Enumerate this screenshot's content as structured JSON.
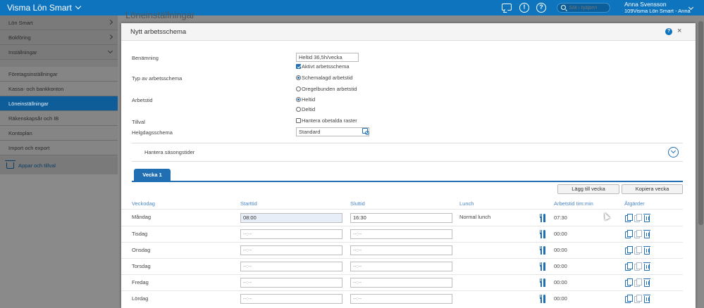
{
  "topbar": {
    "app_title": "Visma Lön Smart",
    "search_placeholder": "Sök i hjälpen",
    "help_symbol": "?",
    "alert_symbol": "!",
    "user_name": "Anna Svensson",
    "user_company": "109Visma Lön Smart - Anna",
    "accent": "#0e74bd"
  },
  "sidebar": {
    "items": [
      {
        "label": "Lön Smart"
      },
      {
        "label": "Bokföring"
      },
      {
        "label": "Inställningar"
      },
      {
        "label": "Företagsinställningar"
      },
      {
        "label": "Kassa- och bankkonton"
      },
      {
        "label": "Löneinställningar"
      },
      {
        "label": "Räkenskapsår och IB"
      },
      {
        "label": "Kontoplan"
      },
      {
        "label": "Import och export"
      }
    ],
    "apps_label": "Appar och tillval"
  },
  "background_title": "Löneinställningar",
  "modal": {
    "title": "Nytt arbetsschema",
    "help_symbol": "?",
    "close_symbol": "×",
    "form": {
      "benamning_label": "Benämning",
      "benamning_value": "Heltid 36,5h/vecka",
      "aktivt_label": "Aktivt arbetsschema",
      "typ_label": "Typ av arbetsschema",
      "typ_opt1": "Schemalagd arbetstid",
      "typ_opt2": "Oregelbunden arbetstid",
      "arbetstid_label": "Arbetstid",
      "arbetstid_opt1": "Heltid",
      "arbetstid_opt2": "Deltid",
      "tillval_label": "Tillval",
      "tillval_opt": "Hantera obetalda raster",
      "helgdag_label": "Helgdagsschema",
      "helgdag_value": "Standard"
    },
    "season_label": "Hantera säsongstider",
    "tab_label": "Vecka 1",
    "add_week_button": "Lägg till vecka",
    "copy_week_button": "Kopiera vecka",
    "table": {
      "headers": {
        "day": "Veckodag",
        "start": "Starttid",
        "end": "Sluttid",
        "lunch": "Lunch",
        "worktime": "Arbetstid tim:min",
        "actions": "Åtgärder"
      },
      "rows": [
        {
          "day": "Måndag",
          "start": "08:00",
          "end": "16:30",
          "lunch": "Normal lunch",
          "worktime": "07:30"
        },
        {
          "day": "Tisdag",
          "start": "--:--",
          "end": "--:--",
          "lunch": "",
          "worktime": "00:00"
        },
        {
          "day": "Onsdag",
          "start": "--:--",
          "end": "--:--",
          "lunch": "",
          "worktime": "00:00"
        },
        {
          "day": "Torsdag",
          "start": "--:--",
          "end": "--:--",
          "lunch": "",
          "worktime": "00:00"
        },
        {
          "day": "Fredag",
          "start": "--:--",
          "end": "--:--",
          "lunch": "",
          "worktime": "00:00"
        },
        {
          "day": "Lördag",
          "start": "--:--",
          "end": "--:--",
          "lunch": "",
          "worktime": "00:00"
        }
      ]
    }
  }
}
